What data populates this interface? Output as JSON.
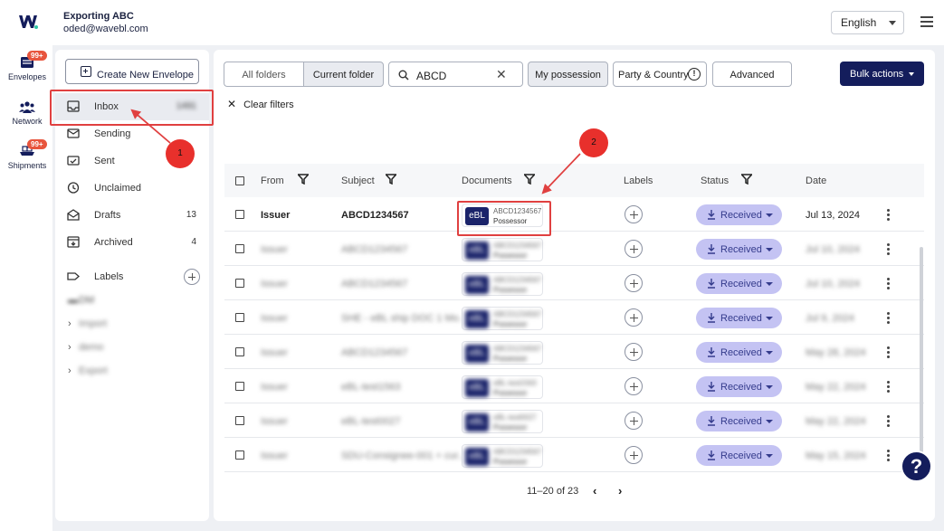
{
  "account": {
    "name": "Exporting ABC",
    "email": "oded@wavebl.com"
  },
  "language": {
    "selected": "English"
  },
  "rail": [
    {
      "label": "Envelopes",
      "badge": "99+",
      "icon": "envelopes-icon"
    },
    {
      "label": "Network",
      "badge": "",
      "icon": "network-icon"
    },
    {
      "label": "Shipments",
      "badge": "99+",
      "icon": "shipments-icon"
    }
  ],
  "folders": {
    "create_label": "Create New Envelope",
    "items": [
      {
        "label": "Inbox",
        "count": "1491",
        "icon": "inbox-icon",
        "active": true
      },
      {
        "label": "Sending",
        "count": "",
        "icon": "sending-icon"
      },
      {
        "label": "Sent",
        "count": "",
        "icon": "sent-icon"
      },
      {
        "label": "Unclaimed",
        "count": "",
        "icon": "unclaimed-icon"
      },
      {
        "label": "Drafts",
        "count": "13",
        "icon": "drafts-icon"
      },
      {
        "label": "Archived",
        "count": "4",
        "icon": "archived-icon"
      }
    ],
    "labels_title": "Labels",
    "label_items": [
      "DM",
      "Import",
      "demo",
      "Export"
    ]
  },
  "annotations": {
    "one": "1",
    "two": "2"
  },
  "toolbar": {
    "all_folders": "All folders",
    "current_folder": "Current folder",
    "search_value": "ABCD",
    "my_possession": "My possession",
    "party_country": "Party & Country",
    "advanced": "Advanced",
    "bulk_actions": "Bulk actions",
    "clear_filters": "Clear filters"
  },
  "table": {
    "headers": {
      "from": "From",
      "subject": "Subject",
      "documents": "Documents",
      "labels": "Labels",
      "status": "Status",
      "date": "Date"
    },
    "rows": [
      {
        "from": "Issuer",
        "subject": "ABCD1234567",
        "doc_type": "eBL",
        "doc_ref": "ABCD1234567",
        "doc_role": "Possessor",
        "status": "Received",
        "date": "Jul 13, 2024",
        "blurred": false
      },
      {
        "from": "Issuer",
        "subject": "ABCD1234567",
        "doc_type": "eBL",
        "doc_ref": "ABCD1234567",
        "doc_role": "Possessor",
        "status": "Received",
        "date": "Jul 10, 2024",
        "blurred": true
      },
      {
        "from": "Issuer",
        "subject": "ABCD1234567",
        "doc_type": "eBL",
        "doc_ref": "ABCD1234567",
        "doc_role": "Possessor",
        "status": "Received",
        "date": "Jul 10, 2024",
        "blurred": true
      },
      {
        "from": "Issuer",
        "subject": "SHE - eBL ship DOC 1 Mo.",
        "doc_type": "eBL",
        "doc_ref": "ABCD1234567",
        "doc_role": "Possessor",
        "status": "Received",
        "date": "Jul 9, 2024",
        "blurred": true
      },
      {
        "from": "Issuer",
        "subject": "ABCD1234567",
        "doc_type": "eBL",
        "doc_ref": "ABCD1234567",
        "doc_role": "Possessor",
        "status": "Received",
        "date": "May 28, 2024",
        "blurred": true
      },
      {
        "from": "Issuer",
        "subject": "eBL-test1563",
        "doc_type": "eBL",
        "doc_ref": "eBL-test1563",
        "doc_role": "Possessor",
        "status": "Received",
        "date": "May 22, 2024",
        "blurred": true
      },
      {
        "from": "Issuer",
        "subject": "eBL-test0027",
        "doc_type": "eBL",
        "doc_ref": "eBL-test0027",
        "doc_role": "Possessor",
        "status": "Received",
        "date": "May 22, 2024",
        "blurred": true
      },
      {
        "from": "Issuer",
        "subject": "SDU-Consignee-001 + cur...",
        "doc_type": "eBL",
        "doc_ref": "ABCD1234567",
        "doc_role": "Possessor",
        "status": "Received",
        "date": "May 15, 2024",
        "blurred": true
      }
    ]
  },
  "pagination": {
    "range": "11–20 of 23"
  },
  "help": {
    "label": "?"
  }
}
